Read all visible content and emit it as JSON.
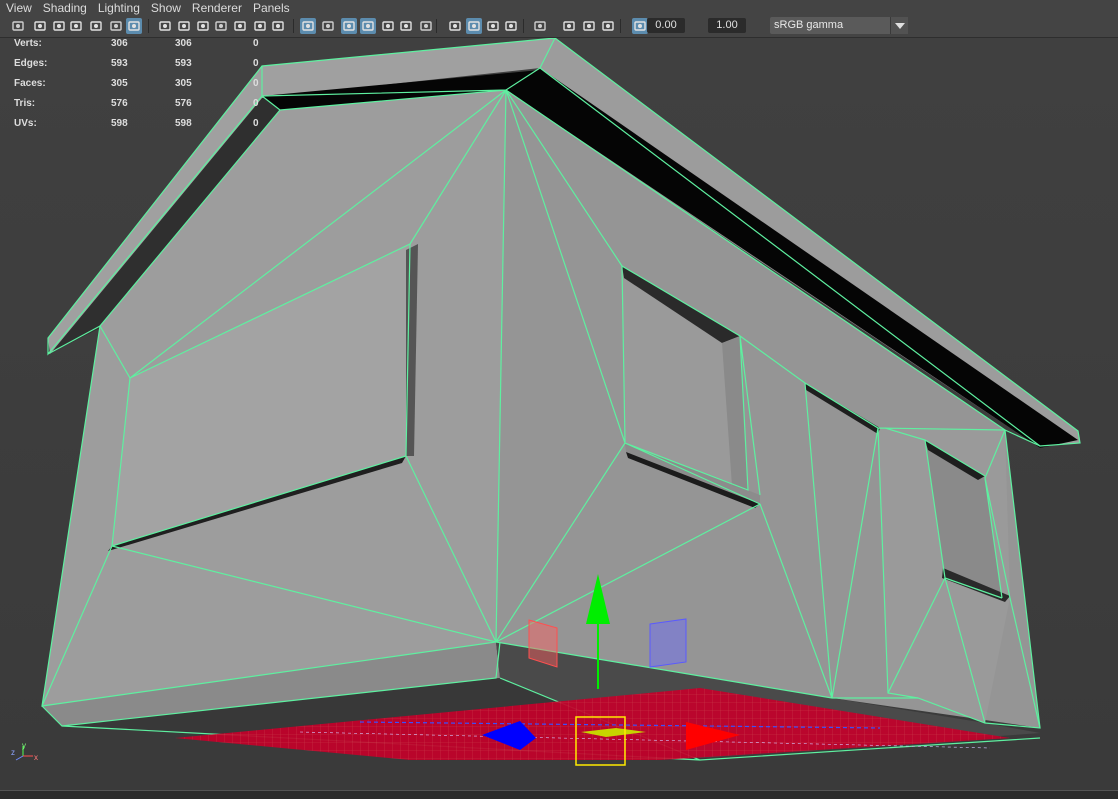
{
  "menubar": {
    "items": [
      "View",
      "Shading",
      "Lighting",
      "Show",
      "Renderer",
      "Panels"
    ]
  },
  "toolbar": {
    "exposure_value": "0.00",
    "gamma_value": "1.00",
    "color_space": "sRGB gamma",
    "icons": [
      "camera-select-icon",
      "camera-attributes-icon",
      "bookmark-icon",
      "image-plane-icon",
      "2d-pan-zoom-icon",
      "grease-pencil-icon",
      "grid-icon",
      "film-gate-icon",
      "resolution-gate-icon",
      "gate-mask-icon",
      "field-chart-icon",
      "safe-action-icon",
      "wireframe-icon",
      "smooth-shade-icon",
      "default-material-icon",
      "wireframe-on-shaded-icon",
      "textured-icon",
      "lights-icon",
      "shadows-icon",
      "screen-space-ao-icon",
      "motion-blur-icon",
      "anti-aliasing-icon",
      "depth-of-field-icon",
      "isolate-select-icon",
      "xray-icon",
      "xray-joints-icon",
      "backface-culling-icon",
      "exposure-icon",
      "gamma-icon",
      "color-management-icon"
    ]
  },
  "hud": {
    "rows": [
      {
        "label": "Verts:",
        "v1": "306",
        "v2": "306",
        "v3": "0"
      },
      {
        "label": "Edges:",
        "v1": "593",
        "v2": "593",
        "v3": "0"
      },
      {
        "label": "Faces:",
        "v1": "305",
        "v2": "305",
        "v3": "0"
      },
      {
        "label": "Tris:",
        "v1": "576",
        "v2": "576",
        "v3": "0"
      },
      {
        "label": "UVs:",
        "v1": "598",
        "v2": "598",
        "v3": "0"
      }
    ]
  },
  "axis_indicator": {
    "x": "x",
    "y": "y",
    "z": "z"
  },
  "colors": {
    "wire_highlight": "#5ef0a0",
    "mesh_face": "#9b9b9b",
    "manipulator_x": "#ff0000",
    "manipulator_y": "#00ee00",
    "manipulator_z": "#0000ff",
    "ground_plane": "#c8002a"
  }
}
